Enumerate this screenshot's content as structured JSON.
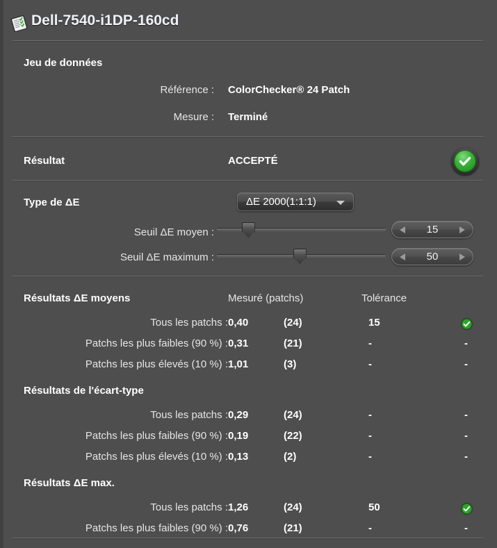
{
  "window": {
    "title": "Dell-7540-i1DP-160cd",
    "title_icon": "report-document-icon"
  },
  "dataset": {
    "heading": "Jeu de données",
    "reference_label": "Référence :",
    "reference_value": "ColorChecker® 24 Patch",
    "measure_label": "Mesure :",
    "measure_value": "Terminé"
  },
  "result": {
    "heading": "Résultat",
    "value": "ACCEPTÉ",
    "status_icon": "green-check-badge-icon"
  },
  "delta_e": {
    "heading": "Type de ΔE",
    "type_selected": "ΔE 2000(1:1:1)",
    "dropdown_icon": "chevron-down-icon",
    "mean_threshold_label": "Seuil ΔE moyen :",
    "mean_threshold_value": "15",
    "mean_slider_percent": 16,
    "max_threshold_label": "Seuil ΔE maximum :",
    "max_threshold_value": "50",
    "max_slider_percent": 49,
    "stepper_left_icon": "triangle-left-icon",
    "stepper_right_icon": "triangle-right-icon"
  },
  "columns": {
    "measured": "Mesuré (patchs)",
    "tolerance": "Tolérance"
  },
  "sections": [
    {
      "heading": "Résultats ΔE moyens",
      "show_columns": true,
      "rows": [
        {
          "label": "Tous les patchs :",
          "measured": "0,40",
          "patches": "(24)",
          "tolerance": "15",
          "status": "pass",
          "status_icon": "green-check-badge-icon"
        },
        {
          "label": "Patchs les plus faibles (90 %) :",
          "measured": "0,31",
          "patches": "(21)",
          "tolerance": "-",
          "status": "none",
          "status_icon": "dash"
        },
        {
          "label": "Patchs les plus élevés (10 %) :",
          "measured": "1,01",
          "patches": "(3)",
          "tolerance": "-",
          "status": "none",
          "status_icon": "dash"
        }
      ]
    },
    {
      "heading": "Résultats de l'écart-type",
      "show_columns": false,
      "rows": [
        {
          "label": "Tous les patchs :",
          "measured": "0,29",
          "patches": "(24)",
          "tolerance": "-",
          "status": "none",
          "status_icon": "dash"
        },
        {
          "label": "Patchs les plus faibles (90 %) :",
          "measured": "0,19",
          "patches": "(22)",
          "tolerance": "-",
          "status": "none",
          "status_icon": "dash"
        },
        {
          "label": "Patchs les plus élevés (10 %) :",
          "measured": "0,13",
          "patches": "(2)",
          "tolerance": "-",
          "status": "none",
          "status_icon": "dash"
        }
      ]
    },
    {
      "heading": "Résultats ΔE max.",
      "show_columns": false,
      "rows": [
        {
          "label": "Tous les patchs :",
          "measured": "1,26",
          "patches": "(24)",
          "tolerance": "50",
          "status": "pass",
          "status_icon": "green-check-badge-icon"
        },
        {
          "label": "Patchs les plus faibles (90 %) :",
          "measured": "0,76",
          "patches": "(21)",
          "tolerance": "-",
          "status": "none",
          "status_icon": "dash"
        }
      ]
    }
  ],
  "colors": {
    "background": "#4e4e4e",
    "text": "#ffffff",
    "title": "#eef2f7",
    "pass_green": "#3cb13a",
    "divider_light": "#6f6f6f",
    "divider_dark": "#3f3f3f"
  }
}
